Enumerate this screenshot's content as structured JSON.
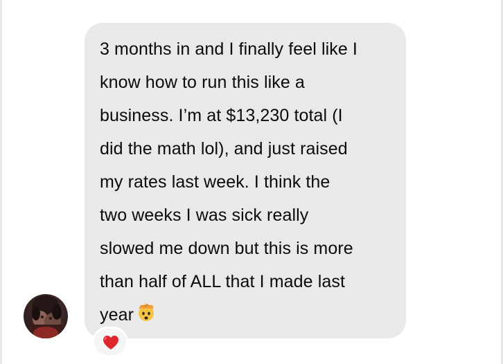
{
  "message": {
    "lines": [
      "3 months in and I finally feel like I",
      "know how to run this like a",
      "business. I’m at $13,230 total (I",
      "did the math lol), and just raised",
      "my rates last week. I think the",
      "two weeks I was sick really",
      "slowed me down but this is more",
      "than half of ALL that I made last",
      "year"
    ],
    "trailing_emoji": "exploding-head-emoji"
  },
  "reaction": {
    "icon": "red-heart-icon",
    "color": "#e0262d"
  },
  "colors": {
    "bubble": "#e9e9e9",
    "text": "#0a0a0a",
    "background": "#ffffff"
  }
}
